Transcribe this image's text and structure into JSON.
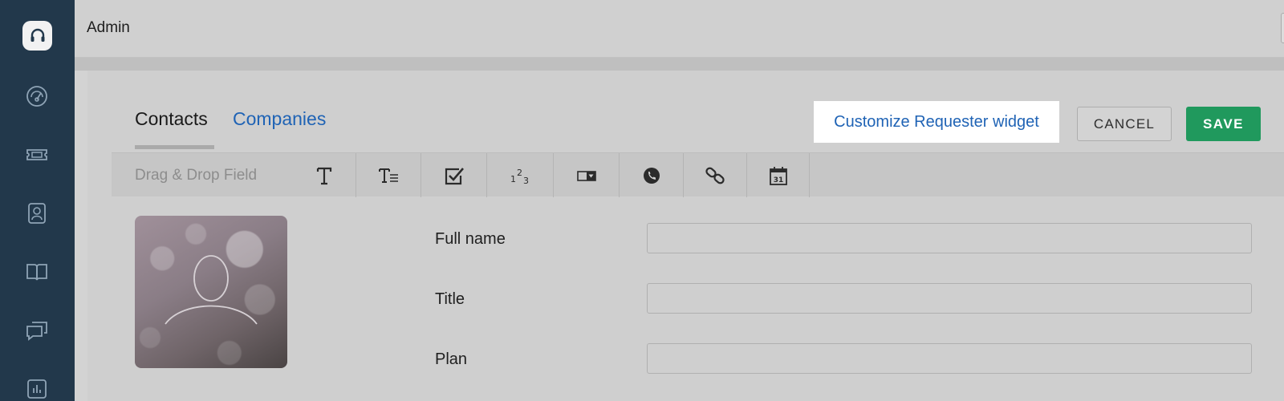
{
  "header": {
    "title": "Admin"
  },
  "sidebar": {
    "items": [
      {
        "icon": "dashboard-icon"
      },
      {
        "icon": "ticket-icon"
      },
      {
        "icon": "contact-icon"
      },
      {
        "icon": "book-icon"
      },
      {
        "icon": "chat-icon"
      },
      {
        "icon": "reports-icon"
      }
    ]
  },
  "tabs": [
    {
      "label": "Contacts",
      "active": true
    },
    {
      "label": "Companies",
      "active": false
    }
  ],
  "actions": {
    "customize_label": "Customize Requester widget",
    "cancel_label": "CANCEL",
    "save_label": "SAVE"
  },
  "field_bar": {
    "label": "Drag & Drop Field",
    "tools": [
      {
        "icon": "single-line-text-icon"
      },
      {
        "icon": "paragraph-text-icon"
      },
      {
        "icon": "checkbox-icon"
      },
      {
        "icon": "number-icon"
      },
      {
        "icon": "dropdown-icon"
      },
      {
        "icon": "phone-icon"
      },
      {
        "icon": "url-icon"
      },
      {
        "icon": "date-icon",
        "text": "31"
      }
    ]
  },
  "form": {
    "fields": [
      {
        "label": "Full name",
        "value": ""
      },
      {
        "label": "Title",
        "value": ""
      },
      {
        "label": "Plan",
        "value": ""
      }
    ]
  },
  "colors": {
    "sidebar_bg": "#22384b",
    "link_blue": "#1f63b5",
    "save_green": "#20995d"
  }
}
